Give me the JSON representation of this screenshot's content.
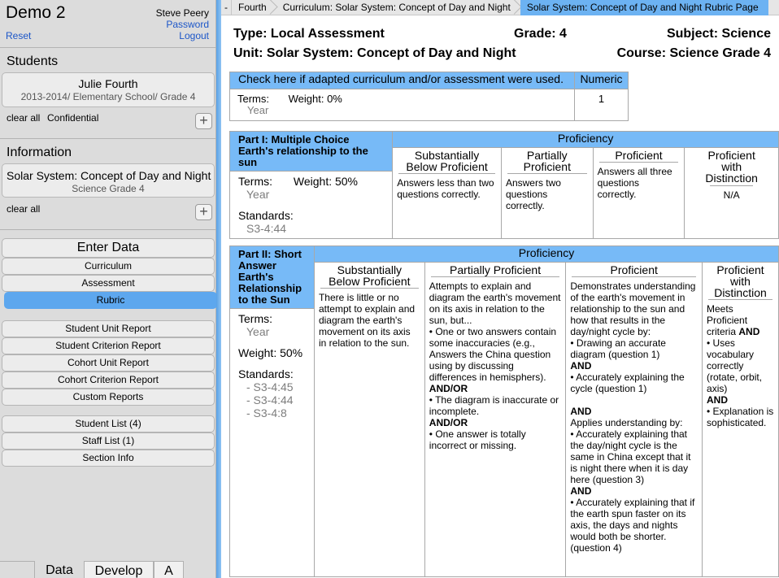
{
  "app": {
    "title": "Demo 2",
    "user_name": "Steve Peery",
    "password_link": "Password",
    "logout_link": "Logout",
    "reset_link": "Reset"
  },
  "students": {
    "title": "Students",
    "selected_name": "Julie Fourth",
    "selected_detail": "2013-2014/ Elementary School/ Grade 4",
    "clear_all": "clear all",
    "confidential": "Confidential",
    "add_icon": "+"
  },
  "information": {
    "title": "Information",
    "unit": "Solar System: Concept of Day and Night",
    "course": "Science Grade 4",
    "clear_all": "clear all",
    "add_icon": "+"
  },
  "nav": {
    "enter_data": "Enter Data",
    "items": [
      "Curriculum",
      "Assessment",
      "Rubric"
    ],
    "active": "Rubric",
    "reports": [
      "Student Unit Report",
      "Student Criterion Report",
      "Cohort Unit Report",
      "Cohort Criterion Report",
      "Custom Reports"
    ],
    "lists": [
      "Student List (4)",
      "Staff List (1)",
      "Section Info"
    ]
  },
  "bottom_tabs": [
    "Data",
    "Develop",
    "A"
  ],
  "breadcrumb": {
    "dash": "-",
    "items": [
      "Fourth",
      "Curriculum: Solar System: Concept of Day and Night",
      "Solar System: Concept of Day and Night Rubric Page"
    ]
  },
  "header": {
    "type": "Type: Local Assessment",
    "grade": "Grade: 4",
    "subject": "Subject: Science",
    "unit": "Unit: Solar System: Concept of Day and Night",
    "course": "Course: Science Grade 4"
  },
  "adapted": {
    "check_label": "Check here if adapted curriculum and/or assessment were used.",
    "numeric_label": "Numeric",
    "terms_label": "Terms:",
    "terms_value": "Year",
    "weight": "Weight: 0%",
    "numeric_value": "1"
  },
  "parts": [
    {
      "title": "Part I: Multiple Choice Earth's relationship to the sun",
      "terms_label": "Terms:",
      "terms_value": "Year",
      "weight": "Weight: 50%",
      "standards_label": "Standards:",
      "standards": [
        "S3-4:44"
      ],
      "proficiency_label": "Proficiency",
      "levels": [
        {
          "name": "Substantially Below Proficient",
          "desc": "Answers less than two questions correctly."
        },
        {
          "name": "Partially Proficient",
          "desc": "Answers two questions correctly."
        },
        {
          "name": "Proficient",
          "desc": "Answers all three questions correctly."
        },
        {
          "name": "Proficient with Distinction",
          "desc": "N/A"
        }
      ]
    },
    {
      "title": "Part II: Short Answer Earth's Relationship to the Sun",
      "terms_label": "Terms:",
      "terms_value": "Year",
      "weight": "Weight: 50%",
      "standards_label": "Standards:",
      "standards": [
        "- S3-4:45",
        "- S3-4:44",
        "- S3-4:8"
      ],
      "proficiency_label": "Proficiency",
      "levels": [
        {
          "name": "Substantially Below Proficient",
          "lines": [
            {
              "t": "There is little or no attempt to explain and diagram the earth's movement on its axis in relation to the sun."
            }
          ]
        },
        {
          "name": "Partially Proficient",
          "lines": [
            {
              "t": "Attempts to explain and diagram the earth's movement on its axis in relation to the sun, but..."
            },
            {
              "t": "• One or two answers contain some inaccuracies (e.g., Answers the China question using by discussing differences in hemisphers)."
            },
            {
              "t": "AND/OR",
              "b": true
            },
            {
              "t": "• The diagram is inaccurate or incomplete."
            },
            {
              "t": "AND/OR",
              "b": true
            },
            {
              "t": "• One answer is totally incorrect or missing."
            }
          ]
        },
        {
          "name": "Proficient",
          "lines": [
            {
              "t": "Demonstrates understanding of the earth's movement in relationship to the sun and how that results in the day/night cycle by:"
            },
            {
              "t": "• Drawing an accurate diagram (question 1)"
            },
            {
              "t": "AND",
              "b": true
            },
            {
              "t": "• Accurately explaining the cycle (question 1)"
            },
            {
              "t": " "
            },
            {
              "t": "AND",
              "b": true
            },
            {
              "t": "Applies understanding by:"
            },
            {
              "t": "• Accurately explaining that the day/night cycle is the same in China except that it is night there when it is day here (question 3)"
            },
            {
              "t": "AND",
              "b": true
            },
            {
              "t": "• Accurately explaining that if the earth spun faster on its axis, the days and nights would both be shorter. (question 4)"
            }
          ]
        },
        {
          "name": "Proficient with Distinction",
          "lines": [
            {
              "t": "Meets Proficient criteria ",
              "tail_bold": "AND"
            },
            {
              "t": "• Uses vocabulary correctly (rotate, orbit, axis)"
            },
            {
              "t": "AND",
              "b": true
            },
            {
              "t": "• Explanation is sophisticated."
            }
          ]
        }
      ]
    }
  ]
}
